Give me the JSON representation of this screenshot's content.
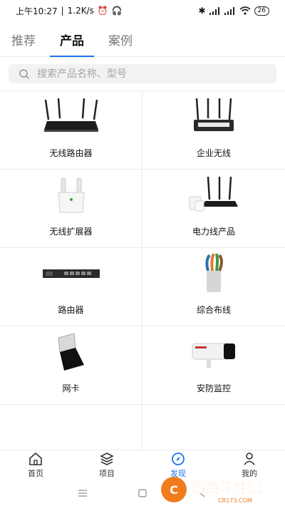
{
  "status": {
    "time": "上午10:27",
    "speed": "1.2K/s",
    "battery": "26"
  },
  "tabs": [
    {
      "label": "推荐",
      "active": false
    },
    {
      "label": "产品",
      "active": true
    },
    {
      "label": "案例",
      "active": false
    }
  ],
  "search": {
    "placeholder": "搜索产品名称、型号"
  },
  "products": [
    {
      "label": "无线路由器",
      "icon": "wifi-router-image"
    },
    {
      "label": "企业无线",
      "icon": "enterprise-router-image"
    },
    {
      "label": "无线扩展器",
      "icon": "range-extender-image"
    },
    {
      "label": "电力线产品",
      "icon": "powerline-image"
    },
    {
      "label": "路由器",
      "icon": "rack-router-image"
    },
    {
      "label": "综合布线",
      "icon": "network-cable-image"
    },
    {
      "label": "网卡",
      "icon": "usb-adapter-image"
    },
    {
      "label": "安防监控",
      "icon": "security-camera-image"
    },
    {
      "label": "",
      "icon": "switch-image"
    },
    {
      "label": "",
      "icon": "nvr-box-image"
    }
  ],
  "bottom_nav": [
    {
      "label": "首页",
      "icon": "home-icon"
    },
    {
      "label": "项目",
      "icon": "layers-icon"
    },
    {
      "label": "发现",
      "icon": "compass-icon",
      "active": true
    },
    {
      "label": "我的",
      "icon": "user-icon"
    }
  ],
  "watermark": {
    "brand": "西西软件园",
    "site": "CR173.COM"
  },
  "colors": {
    "accent": "#1a73e8",
    "watermark": "#f07c1e"
  }
}
